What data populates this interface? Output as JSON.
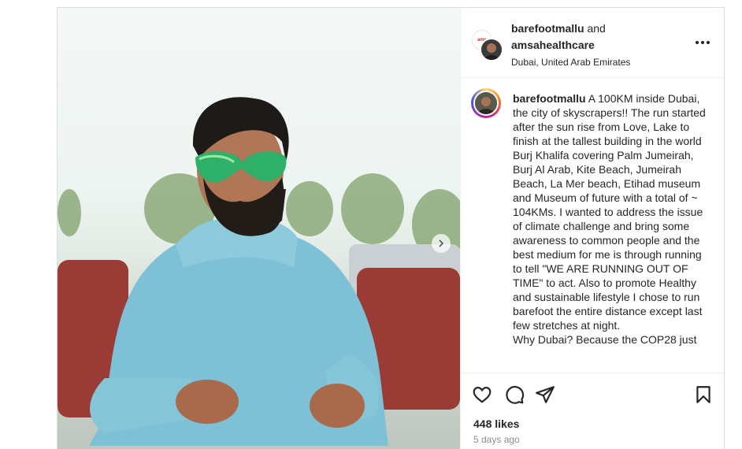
{
  "header": {
    "user1": "barefootmallu",
    "joiner": " and",
    "user2": "amsahealthcare",
    "location": "Dubai, United Arab Emirates"
  },
  "caption": {
    "username": "barefootmallu",
    "text": " A 100KM inside Dubai, the city of skyscrapers!! The run started after the sun rise from Love, Lake to finish at the tallest building in the world Burj Khalifa covering Palm Jumeirah, Burj Al Arab, Kite Beach, Jumeirah Beach, La Mer beach, Etihad museum and Museum of future with a total of ~ 104KMs. I wanted to address the issue of climate challenge and bring some awareness to common people and the best medium for me is through running to tell \"WE ARE RUNNING OUT OF TIME\" to act. Also to promote Healthy and sustainable lifestyle I chose to run barefoot the entire distance except last few stretches at night.",
    "text2": "Why Dubai? Because the COP28 just"
  },
  "stats": {
    "likes": "448 likes",
    "time_ago": "5 days ago"
  },
  "icons": {
    "like": "heart-icon",
    "comment": "comment-icon",
    "share": "share-icon",
    "save": "bookmark-icon",
    "more": "more-icon",
    "next": "chevron-right-icon"
  },
  "colors": {
    "text": "#262626",
    "secondary": "#8e8e8e",
    "border": "#dbdbdb"
  }
}
